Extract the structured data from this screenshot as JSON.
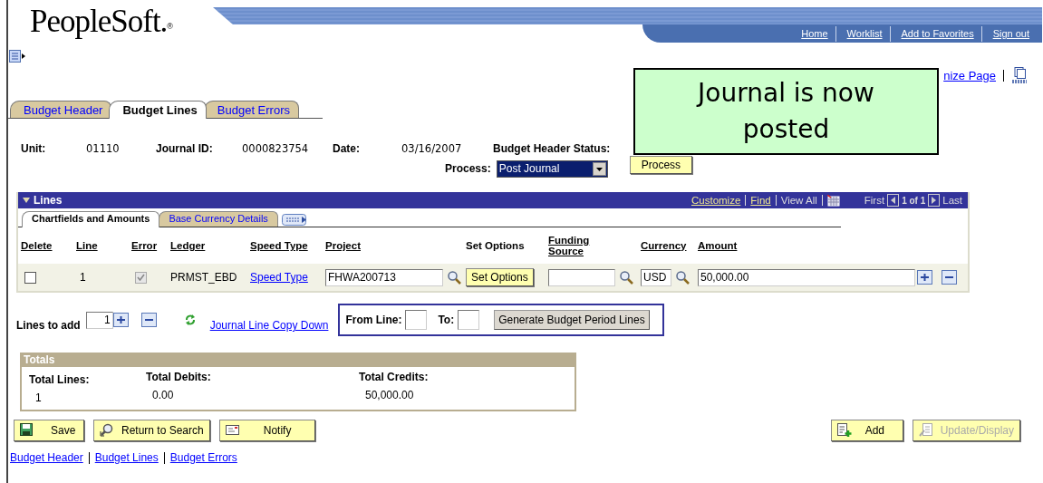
{
  "header": {
    "logo": "PeopleSoft.",
    "logo_mark": "®",
    "nav_links": [
      "Home",
      "Worklist",
      "Add to Favorites",
      "Sign out"
    ]
  },
  "page_link": "nize Page",
  "tabs": [
    {
      "label": "Budget Header",
      "selected": false
    },
    {
      "label": "Budget Lines",
      "selected": true
    },
    {
      "label": "Budget Errors",
      "selected": false
    }
  ],
  "fields": [
    {
      "label": "Unit:",
      "value": "01110"
    },
    {
      "label": "Journal ID:",
      "value": "0000823754"
    },
    {
      "label": "Date:",
      "value": "03/16/2007"
    },
    {
      "label": "Budget Header Status:"
    }
  ],
  "process": {
    "label": "Process:",
    "value": "Post Journal",
    "button": "Process"
  },
  "lines": {
    "title": "Lines",
    "customize": "Customize",
    "find": "Find",
    "view_all": "View All",
    "first": "First",
    "counter": "1 of 1",
    "last": "Last",
    "subtabs": [
      {
        "label": "Chartfields and Amounts",
        "selected": true
      },
      {
        "label": "Base Currency Details",
        "selected": false
      }
    ],
    "columns": [
      {
        "label": "Delete",
        "sortable": true
      },
      {
        "label": "Line",
        "sortable": true
      },
      {
        "label": "Error",
        "sortable": true
      },
      {
        "label": "Ledger",
        "sortable": true
      },
      {
        "label": "Speed Type",
        "sortable": true
      },
      {
        "label": "Project",
        "sortable": true
      },
      {
        "label": "Set Options",
        "sortable": false
      },
      {
        "label": "Funding Source",
        "sortable": true
      },
      {
        "label": "Currency",
        "sortable": true
      },
      {
        "label": "Amount",
        "sortable": true
      }
    ],
    "rows": [
      {
        "delete": {
          "checked": false,
          "disabled": false
        },
        "line": "1",
        "error": {
          "checked": true,
          "disabled": true
        },
        "ledger": "PRMST_EBD",
        "speed_type": "Speed Type",
        "project": "FHWA200713",
        "set_options": "Set Options",
        "funding_source": "",
        "currency": "USD",
        "amount": "50,000.00"
      }
    ]
  },
  "lines_to_add": {
    "label": "Lines to add",
    "value": "1"
  },
  "copy_down": "Journal Line Copy Down",
  "generate": {
    "from_label": "From Line:",
    "to_label": "To:",
    "button": "Generate Budget Period Lines"
  },
  "totals": {
    "title": "Totals",
    "items": [
      {
        "label": "Total Lines:",
        "value": "1"
      },
      {
        "label": "Total Debits:",
        "value": "0.00"
      },
      {
        "label": "Total Credits:",
        "value": "50,000.00"
      }
    ]
  },
  "buttons": [
    {
      "kind": "save",
      "label": "Save",
      "disabled": false
    },
    {
      "kind": "search",
      "label": "Return to Search",
      "disabled": false
    },
    {
      "kind": "notify",
      "label": "Notify",
      "disabled": false
    },
    {
      "kind": "add",
      "label": "Add",
      "disabled": false
    },
    {
      "kind": "update",
      "label": "Update/Display",
      "disabled": true
    }
  ],
  "footer_links": [
    "Budget Header",
    "Budget Lines",
    "Budget Errors"
  ],
  "callout": "Journal is now posted"
}
